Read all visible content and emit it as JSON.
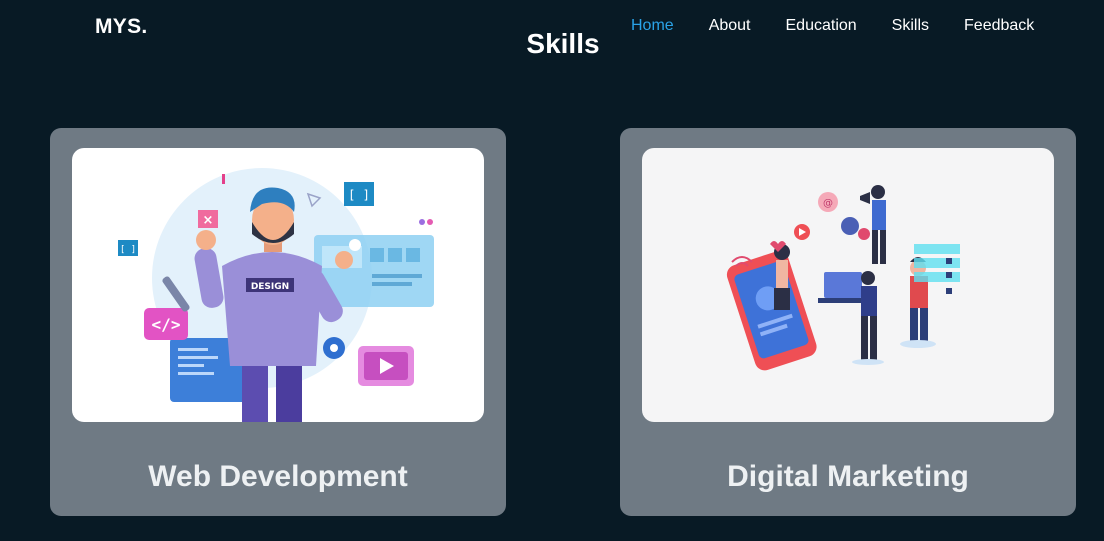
{
  "header": {
    "logo": "MYS.",
    "nav": [
      {
        "label": "Home",
        "active": true
      },
      {
        "label": "About",
        "active": false
      },
      {
        "label": "Education",
        "active": false
      },
      {
        "label": "Skills",
        "active": false
      },
      {
        "label": "Feedback",
        "active": false
      }
    ]
  },
  "main": {
    "title": "Skills",
    "cards": [
      {
        "title": "Web Development",
        "illustration": "web-development-illustration",
        "badge_text": "DESIGN"
      },
      {
        "title": "Digital Marketing",
        "illustration": "digital-marketing-illustration"
      }
    ]
  },
  "colors": {
    "background": "#081a25",
    "card": "#6f7a84",
    "nav_active": "#2aa3e8",
    "text": "#ffffff"
  }
}
